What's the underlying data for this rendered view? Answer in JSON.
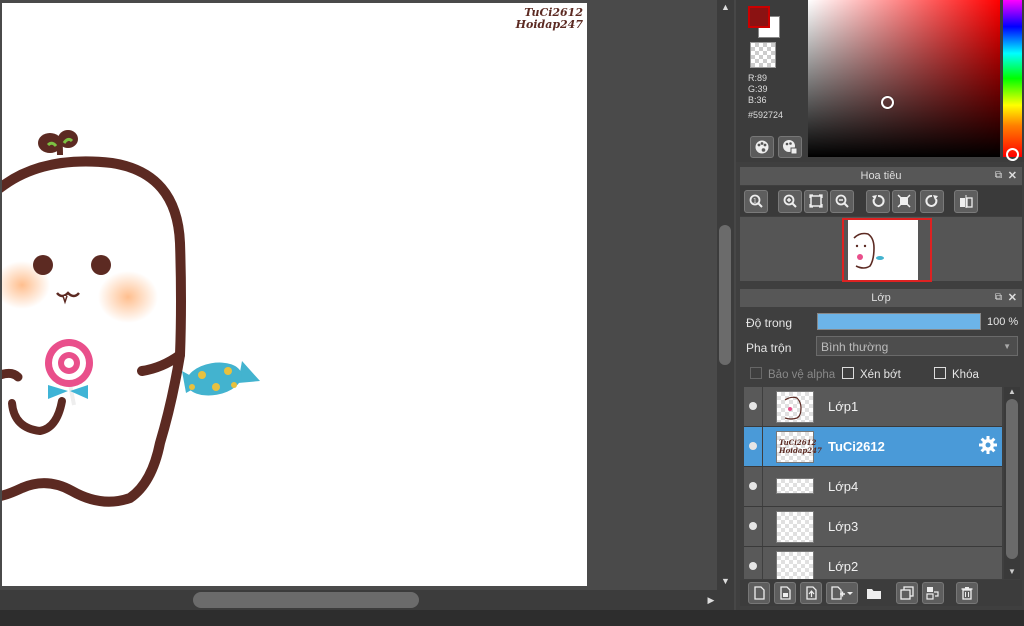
{
  "canvas": {
    "watermark_line1": "TuCi2612",
    "watermark_line2": "Hoidap247"
  },
  "color": {
    "r": "R:89",
    "g": "G:39",
    "b": "B:36",
    "hex": "#592724",
    "foreground": "#592724",
    "background": "#FFFFFF"
  },
  "navigator": {
    "title": "Hoa tiêu"
  },
  "layers_panel": {
    "title": "Lớp",
    "opacity_label": "Độ trong",
    "opacity_value": "100 %",
    "opacity": 1.0,
    "blend_label": "Pha trộn",
    "blend_value": "Bình thường",
    "protect_alpha": "Bảo vệ alpha",
    "clipping": "Xén bớt",
    "lock": "Khóa",
    "layers": [
      {
        "name": "Lớp1",
        "selected": false
      },
      {
        "name": "TuCi2612",
        "selected": true,
        "thumb_line1": "TuCi2612",
        "thumb_line2": "Hoidap247"
      },
      {
        "name": "Lớp4",
        "selected": false
      },
      {
        "name": "Lớp3",
        "selected": false
      },
      {
        "name": "Lớp2",
        "selected": false
      }
    ]
  },
  "icons": {
    "navigator": [
      "zoom-fit-icon",
      "zoom-in-icon",
      "fit-screen-icon",
      "zoom-out-icon",
      "rotate-left-icon",
      "actual-size-icon",
      "rotate-right-icon",
      "flip-icon"
    ],
    "layer_toolbar": [
      "new-layer-icon",
      "new-layer-from-file-icon",
      "import-layer-icon",
      "add-layer-dropdown-icon",
      "folder-icon",
      "duplicate-layer-icon",
      "merge-layer-icon",
      "delete-layer-icon"
    ]
  }
}
